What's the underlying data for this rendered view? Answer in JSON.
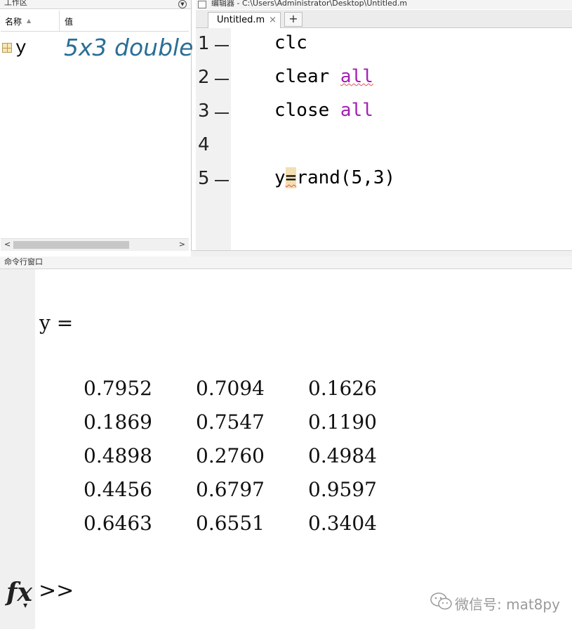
{
  "workspace": {
    "title": "工作区",
    "col_name": "名称",
    "col_value": "值",
    "sort_indicator": "▲",
    "variables": [
      {
        "name": "y",
        "value": "5x3 double"
      }
    ],
    "menu_icon": "chevron-down-circle-icon"
  },
  "editor": {
    "title": "编辑器 - C:\\Users\\Administrator\\Desktop\\Untitled.m",
    "tab_label": "Untitled.m",
    "tab_close": "×",
    "add_tab": "+",
    "lines": [
      {
        "num": "1",
        "has_breakpoint_dash": true,
        "code": "clc"
      },
      {
        "num": "2",
        "has_breakpoint_dash": true,
        "code_a": "clear ",
        "code_kw": "all"
      },
      {
        "num": "3",
        "has_breakpoint_dash": true,
        "code_a": "close ",
        "code_kw": "all"
      },
      {
        "num": "4",
        "has_breakpoint_dash": false,
        "code": ""
      },
      {
        "num": "5",
        "has_breakpoint_dash": true,
        "code_a": "y",
        "code_hl": "=",
        "code_b": "rand(5,3)"
      }
    ],
    "keyword_color": "#a31fb5"
  },
  "command_window": {
    "title": "命令行窗口",
    "var_line": "y =",
    "matrix": [
      [
        "0.7952",
        "0.7094",
        "0.1626"
      ],
      [
        "0.1869",
        "0.7547",
        "0.1190"
      ],
      [
        "0.4898",
        "0.2760",
        "0.4984"
      ],
      [
        "0.4456",
        "0.6797",
        "0.9597"
      ],
      [
        "0.6463",
        "0.6551",
        "0.3404"
      ]
    ],
    "fx_label": "fx",
    "prompt": ">>"
  },
  "watermark": {
    "text": "微信号: mat8py",
    "icon": "wechat-icon"
  },
  "scrollbar": {
    "left_arrow": "<",
    "right_arrow": ">"
  }
}
